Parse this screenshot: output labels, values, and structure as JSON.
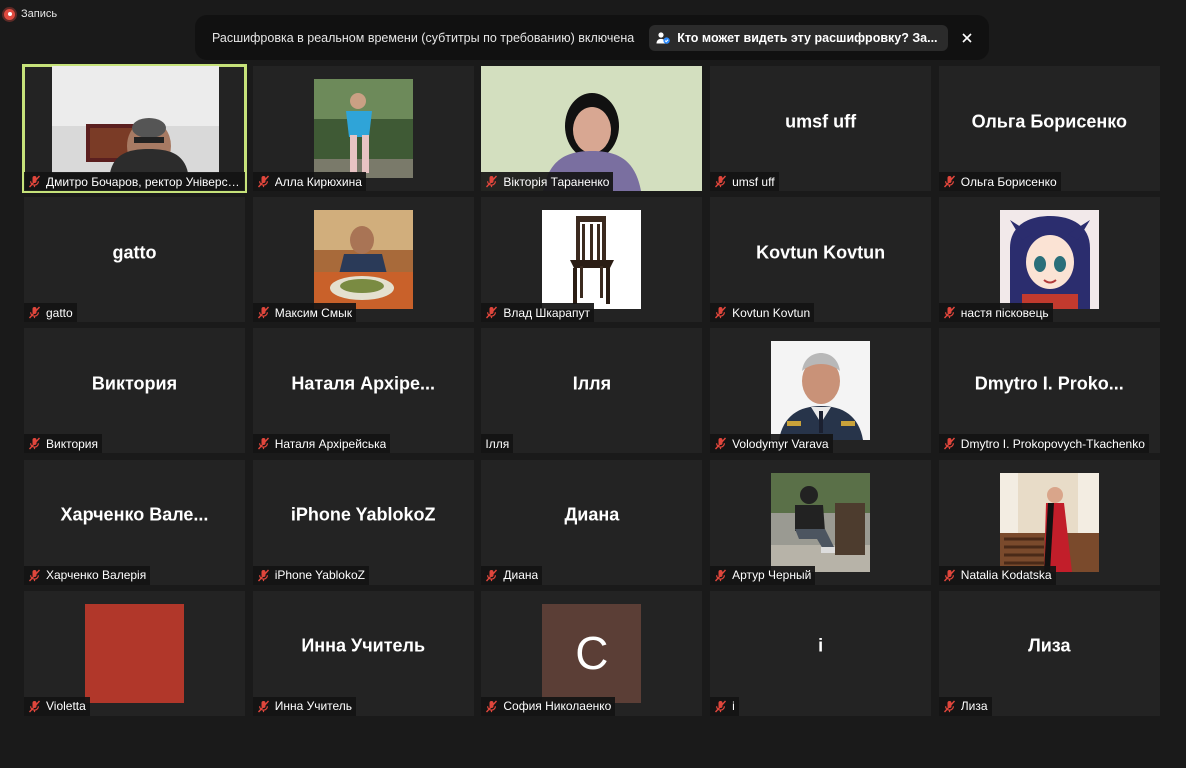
{
  "recording": {
    "label": "Запись",
    "color": "#e04a3f"
  },
  "transcript_banner": {
    "text": "Расшифровка в реальном времени (субтитры по требованию) включена",
    "who_button": "Кто может видеть эту расшифровку? За...",
    "close_icon": "close-icon"
  },
  "colors": {
    "active_speaker_border": "#c6e27a",
    "tile_bg": "#232323",
    "muted_mic": "#e0463c"
  },
  "participants": [
    {
      "label": "Дмитро Бочаров, ректор Університе...",
      "muted": true,
      "video": "camera"
    },
    {
      "label": "Алла Кирюхина",
      "muted": true,
      "video": "photo"
    },
    {
      "label": "Вікторія Тараненко",
      "muted": true,
      "video": "camera"
    },
    {
      "label": "umsf uff",
      "name": "umsf uff",
      "muted": true
    },
    {
      "label": "Ольга Борисенко",
      "name": "Ольга Борисенко",
      "muted": true
    },
    {
      "label": "gatto",
      "name": "gatto",
      "muted": true
    },
    {
      "label": "Максим Смык",
      "muted": true,
      "video": "photo"
    },
    {
      "label": "Влад Шкарапут",
      "muted": true,
      "video": "photo"
    },
    {
      "label": "Kovtun Kovtun",
      "name": "Kovtun Kovtun",
      "muted": true
    },
    {
      "label": "настя пісковець",
      "muted": true,
      "video": "photo"
    },
    {
      "label": "Виктория",
      "name": "Виктория",
      "muted": true
    },
    {
      "label": "Наталя Архірейська",
      "name": "Наталя Архіре...",
      "muted": true
    },
    {
      "label": "Ілля",
      "name": "Ілля",
      "muted": false
    },
    {
      "label": "Volodymyr Varava",
      "muted": true,
      "video": "photo"
    },
    {
      "label": "Dmytro I. Prokopovych-Tkachenko",
      "name": "Dmytro I. Proko...",
      "muted": true
    },
    {
      "label": "Харченко Валерія",
      "name": "Харченко Вале...",
      "muted": true
    },
    {
      "label": "iPhone YablokoZ",
      "name": "iPhone YablokoZ",
      "muted": true
    },
    {
      "label": "Диана",
      "name": "Диана",
      "muted": true
    },
    {
      "label": "Артур Черный",
      "muted": true,
      "video": "photo"
    },
    {
      "label": "Natalia Kodatska",
      "muted": true,
      "video": "photo"
    },
    {
      "label": "Violetta",
      "muted": true,
      "video": "photo",
      "avatar_color": "#b1372a"
    },
    {
      "label": "Инна Учитель",
      "name": "Инна Учитель",
      "muted": true
    },
    {
      "label": "София Николаенко",
      "name": "C",
      "muted": true,
      "avatar_color": "#5b3e36"
    },
    {
      "label": "i",
      "name": "i",
      "muted": true
    },
    {
      "label": "Лиза",
      "name": "Лиза",
      "muted": true
    }
  ]
}
